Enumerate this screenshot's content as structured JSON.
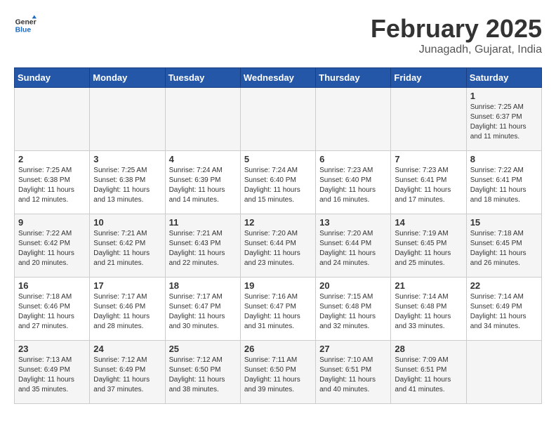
{
  "logo": {
    "line1": "General",
    "line2": "Blue"
  },
  "title": "February 2025",
  "subtitle": "Junagadh, Gujarat, India",
  "days_of_week": [
    "Sunday",
    "Monday",
    "Tuesday",
    "Wednesday",
    "Thursday",
    "Friday",
    "Saturday"
  ],
  "weeks": [
    [
      {
        "day": "",
        "info": ""
      },
      {
        "day": "",
        "info": ""
      },
      {
        "day": "",
        "info": ""
      },
      {
        "day": "",
        "info": ""
      },
      {
        "day": "",
        "info": ""
      },
      {
        "day": "",
        "info": ""
      },
      {
        "day": "1",
        "info": "Sunrise: 7:25 AM\nSunset: 6:37 PM\nDaylight: 11 hours\nand 11 minutes."
      }
    ],
    [
      {
        "day": "2",
        "info": "Sunrise: 7:25 AM\nSunset: 6:38 PM\nDaylight: 11 hours\nand 12 minutes."
      },
      {
        "day": "3",
        "info": "Sunrise: 7:25 AM\nSunset: 6:38 PM\nDaylight: 11 hours\nand 13 minutes."
      },
      {
        "day": "4",
        "info": "Sunrise: 7:24 AM\nSunset: 6:39 PM\nDaylight: 11 hours\nand 14 minutes."
      },
      {
        "day": "5",
        "info": "Sunrise: 7:24 AM\nSunset: 6:40 PM\nDaylight: 11 hours\nand 15 minutes."
      },
      {
        "day": "6",
        "info": "Sunrise: 7:23 AM\nSunset: 6:40 PM\nDaylight: 11 hours\nand 16 minutes."
      },
      {
        "day": "7",
        "info": "Sunrise: 7:23 AM\nSunset: 6:41 PM\nDaylight: 11 hours\nand 17 minutes."
      },
      {
        "day": "8",
        "info": "Sunrise: 7:22 AM\nSunset: 6:41 PM\nDaylight: 11 hours\nand 18 minutes."
      }
    ],
    [
      {
        "day": "9",
        "info": "Sunrise: 7:22 AM\nSunset: 6:42 PM\nDaylight: 11 hours\nand 20 minutes."
      },
      {
        "day": "10",
        "info": "Sunrise: 7:21 AM\nSunset: 6:42 PM\nDaylight: 11 hours\nand 21 minutes."
      },
      {
        "day": "11",
        "info": "Sunrise: 7:21 AM\nSunset: 6:43 PM\nDaylight: 11 hours\nand 22 minutes."
      },
      {
        "day": "12",
        "info": "Sunrise: 7:20 AM\nSunset: 6:44 PM\nDaylight: 11 hours\nand 23 minutes."
      },
      {
        "day": "13",
        "info": "Sunrise: 7:20 AM\nSunset: 6:44 PM\nDaylight: 11 hours\nand 24 minutes."
      },
      {
        "day": "14",
        "info": "Sunrise: 7:19 AM\nSunset: 6:45 PM\nDaylight: 11 hours\nand 25 minutes."
      },
      {
        "day": "15",
        "info": "Sunrise: 7:18 AM\nSunset: 6:45 PM\nDaylight: 11 hours\nand 26 minutes."
      }
    ],
    [
      {
        "day": "16",
        "info": "Sunrise: 7:18 AM\nSunset: 6:46 PM\nDaylight: 11 hours\nand 27 minutes."
      },
      {
        "day": "17",
        "info": "Sunrise: 7:17 AM\nSunset: 6:46 PM\nDaylight: 11 hours\nand 28 minutes."
      },
      {
        "day": "18",
        "info": "Sunrise: 7:17 AM\nSunset: 6:47 PM\nDaylight: 11 hours\nand 30 minutes."
      },
      {
        "day": "19",
        "info": "Sunrise: 7:16 AM\nSunset: 6:47 PM\nDaylight: 11 hours\nand 31 minutes."
      },
      {
        "day": "20",
        "info": "Sunrise: 7:15 AM\nSunset: 6:48 PM\nDaylight: 11 hours\nand 32 minutes."
      },
      {
        "day": "21",
        "info": "Sunrise: 7:14 AM\nSunset: 6:48 PM\nDaylight: 11 hours\nand 33 minutes."
      },
      {
        "day": "22",
        "info": "Sunrise: 7:14 AM\nSunset: 6:49 PM\nDaylight: 11 hours\nand 34 minutes."
      }
    ],
    [
      {
        "day": "23",
        "info": "Sunrise: 7:13 AM\nSunset: 6:49 PM\nDaylight: 11 hours\nand 35 minutes."
      },
      {
        "day": "24",
        "info": "Sunrise: 7:12 AM\nSunset: 6:49 PM\nDaylight: 11 hours\nand 37 minutes."
      },
      {
        "day": "25",
        "info": "Sunrise: 7:12 AM\nSunset: 6:50 PM\nDaylight: 11 hours\nand 38 minutes."
      },
      {
        "day": "26",
        "info": "Sunrise: 7:11 AM\nSunset: 6:50 PM\nDaylight: 11 hours\nand 39 minutes."
      },
      {
        "day": "27",
        "info": "Sunrise: 7:10 AM\nSunset: 6:51 PM\nDaylight: 11 hours\nand 40 minutes."
      },
      {
        "day": "28",
        "info": "Sunrise: 7:09 AM\nSunset: 6:51 PM\nDaylight: 11 hours\nand 41 minutes."
      },
      {
        "day": "",
        "info": ""
      }
    ]
  ]
}
